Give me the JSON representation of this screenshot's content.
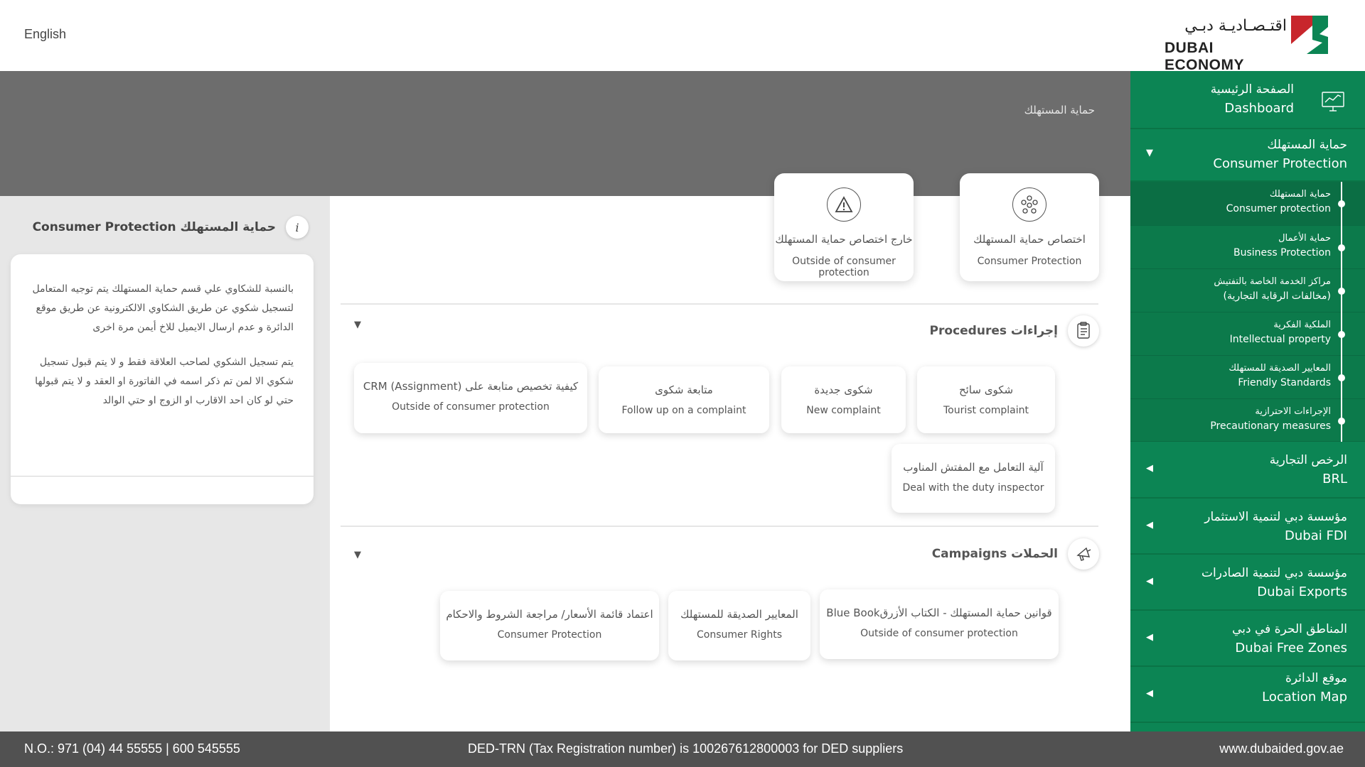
{
  "header": {
    "language_label": "English",
    "logo_ar": "اقتـصـاديـة دبـي",
    "logo_en": "DUBAI ECONOMY"
  },
  "banner": {
    "title": "حماية المستهلك"
  },
  "top_cards": [
    {
      "ar": "خارج اختصاص حماية المستهلك",
      "en": "Outside of consumer protection",
      "icon": "warning-icon"
    },
    {
      "ar": "اختصاص حماية المستهلك",
      "en": "Consumer Protection",
      "icon": "network-icon"
    }
  ],
  "left_panel": {
    "title": "Consumer Protection  حماية المستهلك",
    "info_icon": "i",
    "paragraph1": "بالنسبة للشكاوي علي قسم حماية المستهلك يتم توجيه المتعامل لتسجيل شكوي عن طريق الشكاوي الالكترونية عن طريق موقع الدائرة  و عدم ارسال الايميل للاخ أيمن مرة اخرى",
    "paragraph2": "يتم تسجيل الشكوي لصاحب العلاقة فقط و لا يتم قبول تسجيل شكوي الا لمن تم ذكر اسمه في الفاتورة او العقد و لا يتم قبولها حتي لو كان احد الاقارب او الزوج او حتي الوالد"
  },
  "procedures": {
    "title": "Procedures  إجراءات",
    "tiles": [
      {
        "ar": "شكوى سائح",
        "en": "Tourist complaint"
      },
      {
        "ar": "شكوى جديدة",
        "en": "New complaint"
      },
      {
        "ar": "متابعة شكوى",
        "en": "Follow up on a complaint"
      },
      {
        "ar": "كيفية تخصيص متابعة على CRM (Assignment)",
        "en": "Outside of consumer protection"
      },
      {
        "ar": "آلية التعامل مع المفتش المناوب",
        "en": "Deal with the duty inspector"
      }
    ]
  },
  "campaigns": {
    "title": "Campaigns  الحملات",
    "tiles": [
      {
        "ar": "قوانين حماية المستهلك - الكتاب الأزرقBlue Book",
        "en": "Outside of consumer protection"
      },
      {
        "ar": "المعايير الصديقة للمستهلك",
        "en": "Consumer Rights"
      },
      {
        "ar": "اعتماد قائمة الأسعار/ مراجعة الشروط والاحكام",
        "en": "Consumer Protection"
      }
    ]
  },
  "sidebar": {
    "dashboard": {
      "ar": "الصفحة الرئيسية",
      "en": "Dashboard"
    },
    "consumer": {
      "ar": "حماية المستهلك",
      "en": "Consumer Protection"
    },
    "sub_items": [
      {
        "ar": "حماية المستهلك",
        "en": "Consumer protection"
      },
      {
        "ar": "حماية الأعمال",
        "en": "Business Protection"
      },
      {
        "ar": "مراكز الخدمة الخاصة بالتفتيش",
        "en": "(مخالفات الرقابة التجارية)"
      },
      {
        "ar": "الملكية الفكرية",
        "en": "Intellectual property"
      },
      {
        "ar": "المعايير الصديقة للمستهلك",
        "en": "Friendly Standards"
      },
      {
        "ar": "الإجراءات الاحترازية",
        "en": "Precautionary measures"
      }
    ],
    "main_items": [
      {
        "ar": "الرخص التجارية",
        "en": "BRL"
      },
      {
        "ar": "مؤسسة دبي لتنمية الاستثمار",
        "en": "Dubai FDI"
      },
      {
        "ar": "مؤسسة دبي لتنمية الصادرات",
        "en": "Dubai Exports"
      },
      {
        "ar": "المناطق الحرة في دبي",
        "en": "Dubai Free Zones"
      },
      {
        "ar": "موقع الدائرة",
        "en": "Location Map"
      }
    ]
  },
  "footer": {
    "phone": "N.O.:  971 (04) 44 55555 | 600 545555",
    "trn": "DED-TRN (Tax Registration number) is 100267612800003 for DED suppliers",
    "website": "www.dubaided.gov.ae"
  },
  "colors": {
    "sidebar_green": "#0c8554",
    "banner_gray": "#6d6d6d",
    "footer_gray": "#515151",
    "logo_red": "#c8262c"
  }
}
